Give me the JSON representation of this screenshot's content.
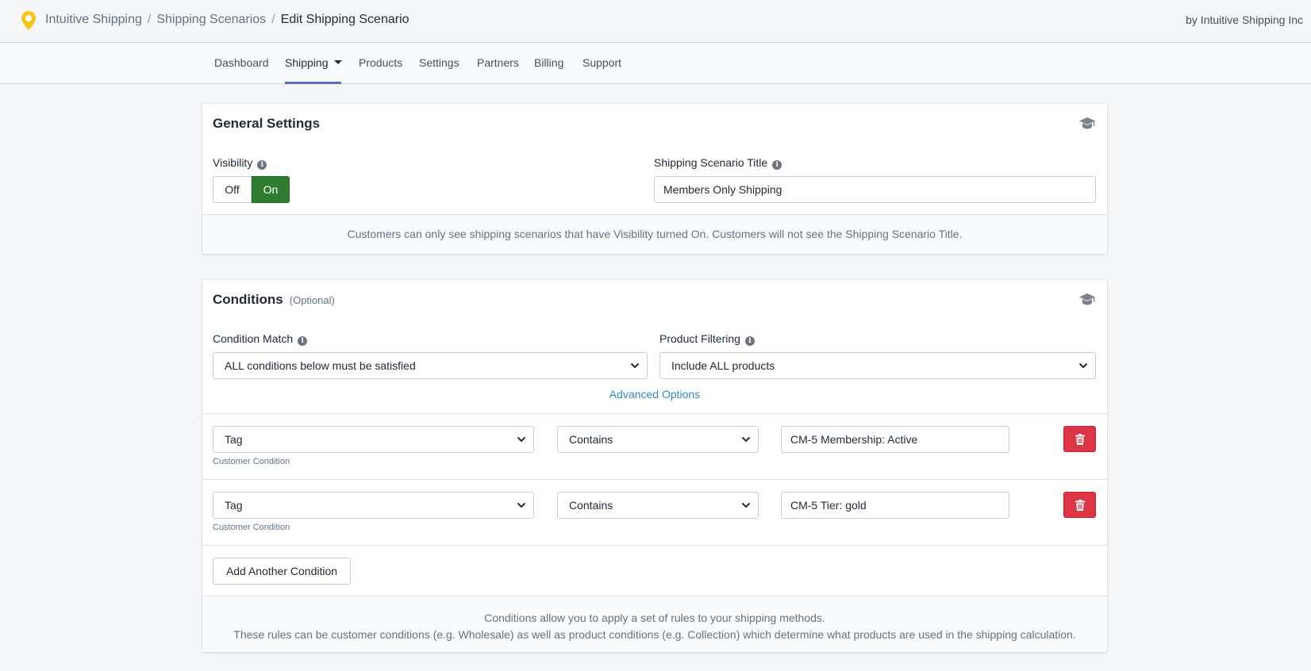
{
  "header": {
    "breadcrumb": [
      "Intuitive Shipping",
      "Shipping Scenarios",
      "Edit Shipping Scenario"
    ],
    "byline": "by Intuitive Shipping Inc",
    "logo_icon": "map-pin-icon",
    "logo_color": "#f5c518"
  },
  "nav": {
    "items": [
      "Dashboard",
      "Shipping",
      "Products",
      "Settings",
      "Partners",
      "Billing",
      "Support"
    ],
    "active": "Shipping",
    "accent": "#5c6ac4"
  },
  "general": {
    "title": "General Settings",
    "visibility_label": "Visibility",
    "off_label": "Off",
    "on_label": "On",
    "visibility_state": "On",
    "on_color": "#2e7d32",
    "scenario_title_label": "Shipping Scenario Title",
    "scenario_title_value": "Members Only Shipping",
    "footer": "Customers can only see shipping scenarios that have Visibility turned On. Customers will not see the Shipping Scenario Title."
  },
  "conditions": {
    "title": "Conditions",
    "optional": "(Optional)",
    "match_label": "Condition Match",
    "match_value": "ALL conditions below must be satisfied",
    "filtering_label": "Product Filtering",
    "filtering_value": "Include ALL products",
    "advanced_link": "Advanced Options",
    "rows": [
      {
        "field": "Tag",
        "sub_label": "Customer Condition",
        "operator": "Contains",
        "value": "CM-5 Membership: Active"
      },
      {
        "field": "Tag",
        "sub_label": "Customer Condition",
        "operator": "Contains",
        "value": "CM-5 Tier: gold"
      }
    ],
    "add_button": "Add Another Condition",
    "footer_line1": "Conditions allow you to apply a set of rules to your shipping methods.",
    "footer_line2": "These rules can be customer conditions (e.g. Wholesale) as well as product conditions (e.g. Collection) which determine what products are used in the shipping calculation.",
    "delete_color": "#dc3545"
  }
}
